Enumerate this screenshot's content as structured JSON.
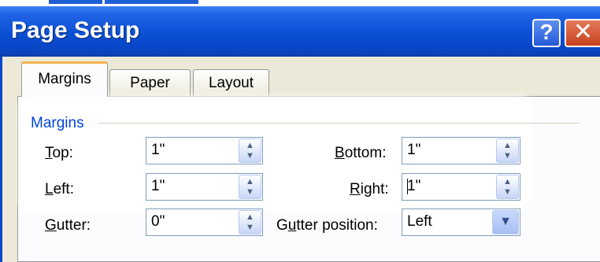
{
  "window": {
    "title": "Page Setup",
    "help_glyph": "?",
    "close_glyph": "✕"
  },
  "tabs": [
    {
      "label": "Margins",
      "active": true
    },
    {
      "label": "Paper",
      "active": false
    },
    {
      "label": "Layout",
      "active": false
    }
  ],
  "margins_group": {
    "label": "Margins",
    "top": {
      "label_prefix": "",
      "label_key": "T",
      "label_rest": "op:",
      "value": "1\""
    },
    "left": {
      "label_prefix": "",
      "label_key": "L",
      "label_rest": "eft:",
      "value": "1\""
    },
    "bottom": {
      "label_prefix": "",
      "label_key": "B",
      "label_rest": "ottom:",
      "value": "1\""
    },
    "right": {
      "label_prefix": "",
      "label_key": "R",
      "label_rest": "ight:",
      "value": "1\""
    },
    "gutter": {
      "label_prefix": "",
      "label_key": "G",
      "label_rest": "utter:",
      "value": "0\""
    },
    "gutter_position": {
      "label_prefix": "G",
      "label_key": "u",
      "label_rest": "tter position:",
      "value": "Left"
    }
  },
  "icons": {
    "spin": "spin-arrows-icon",
    "dropdown": "chevron-down-icon"
  }
}
